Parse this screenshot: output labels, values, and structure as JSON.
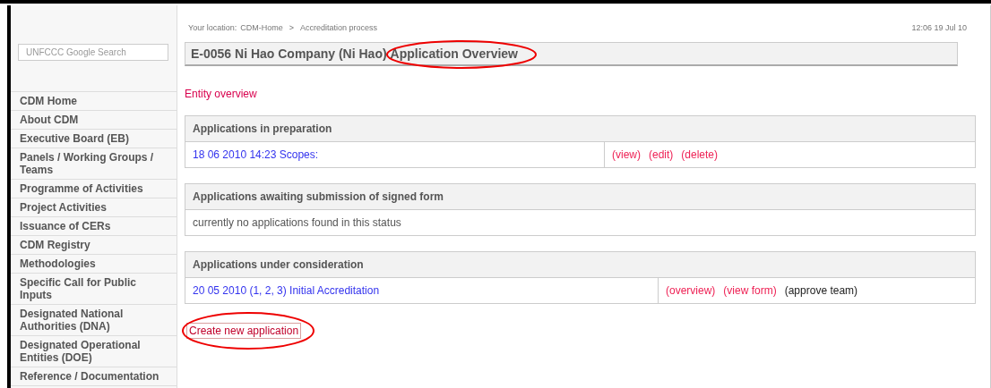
{
  "search": {
    "placeholder": "UNFCCC Google Search"
  },
  "sidebar": {
    "items": [
      "CDM Home",
      "About CDM",
      "Executive Board (EB)",
      "Panels / Working Groups / Teams",
      "Programme of Activities",
      "Project Activities",
      "Issuance of CERs",
      "CDM Registry",
      "Methodologies",
      "Specific Call for Public Inputs",
      "Designated National Authorities (DNA)",
      "Designated Operational Entities (DOE)",
      "Reference / Documentation"
    ]
  },
  "breadcrumb": {
    "label": "Your location:",
    "items": [
      "CDM-Home",
      "Accreditation process"
    ],
    "separator": ">"
  },
  "timestamp": "12:06 19 Jul 10",
  "title": {
    "entity": "E-0056 Ni Hao Company (Ni Hao)",
    "page": "Application Overview"
  },
  "entity_link": "Entity overview",
  "panels": [
    {
      "title": "Applications in preparation",
      "rows": [
        {
          "kind": "entry",
          "text": "18 06 2010 14:23 Scopes:",
          "actions": [
            {
              "kind": "link",
              "label": "(view)"
            },
            {
              "kind": "link",
              "label": "(edit)"
            },
            {
              "kind": "link",
              "label": "(delete)"
            }
          ]
        }
      ]
    },
    {
      "title": "Applications awaiting submission of signed form",
      "rows": [
        {
          "kind": "empty",
          "text": "currently no applications found in this status"
        }
      ]
    },
    {
      "title": "Applications under consideration",
      "rows": [
        {
          "kind": "entry",
          "text": "20 05 2010 (1, 2, 3) Initial Accreditation",
          "actions": [
            {
              "kind": "link",
              "label": "(overview)"
            },
            {
              "kind": "link",
              "label": "(view form)"
            },
            {
              "kind": "text",
              "label": "(approve team)"
            }
          ]
        }
      ]
    }
  ],
  "create_button": "Create new application"
}
